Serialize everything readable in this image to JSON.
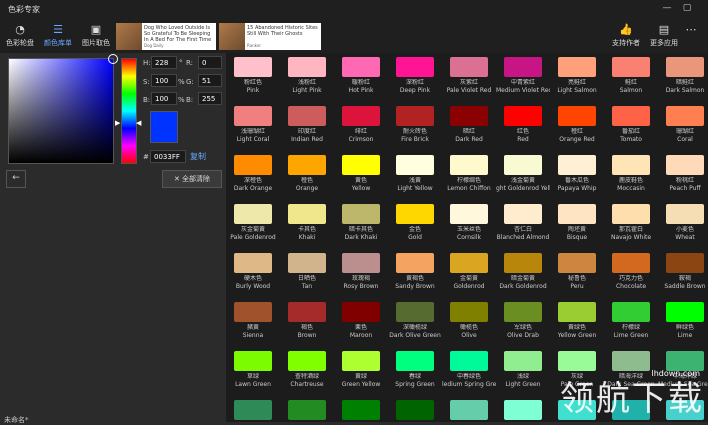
{
  "window": {
    "title": "色彩专家",
    "controls": [
      "—",
      "▢"
    ]
  },
  "toolbar": {
    "left": [
      {
        "icon": "palette-icon",
        "glyph": "◔",
        "label": "色彩轮盘",
        "active": false
      },
      {
        "icon": "list-icon",
        "glyph": "☰",
        "label": "颜色库单",
        "active": true
      },
      {
        "icon": "image-icon",
        "glyph": "▣",
        "label": "图片取色",
        "active": false
      }
    ],
    "right": [
      {
        "icon": "thumbs-up-icon",
        "glyph": "👍",
        "label": "支持作者"
      },
      {
        "icon": "apps-icon",
        "glyph": "▤",
        "label": "更多应用"
      },
      {
        "icon": "more-icon",
        "glyph": "⋯",
        "label": ""
      }
    ],
    "ads": [
      {
        "text": "Dog Who Loved Outside Is So Grateful To Be Sleeping In A Bed For The First Time",
        "src": "Dog Daily"
      },
      {
        "text": "15 Abandoned Historic Sites Still With Their Ghosts",
        "src": "Ranker"
      }
    ]
  },
  "picker": {
    "h_label": "H:",
    "h_value": "228",
    "s_label": "S:",
    "s_value": "100",
    "b_label": "B:",
    "b_value": "100",
    "r_label": "R:",
    "r_value": "0",
    "g_label": "G:",
    "g_value": "51",
    "bl_label": "B:",
    "bl_value": "255",
    "pct1": "%",
    "pct2": "%",
    "hex_label": "#",
    "hex_value": "0033FF",
    "copy_label": "复制",
    "back_label": "←",
    "clear_label": "✕ 全部清除",
    "current_color": "#0033ff"
  },
  "footer": {
    "unnamed": "未命名*"
  },
  "colors": [
    {
      "cn": "粉红色",
      "en": "Pink",
      "hex": "#ffc0cb"
    },
    {
      "cn": "浅粉红",
      "en": "Light Pink",
      "hex": "#ffb6c1"
    },
    {
      "cn": "暖粉红",
      "en": "Hot Pink",
      "hex": "#ff69b4"
    },
    {
      "cn": "深粉红",
      "en": "Deep Pink",
      "hex": "#ff1493"
    },
    {
      "cn": "灰紫红",
      "en": "Pale Violet Red",
      "hex": "#db7093"
    },
    {
      "cn": "中青紫红",
      "en": "Medium Violet Red",
      "hex": "#c71585"
    },
    {
      "cn": "亮鲑红",
      "en": "Light Salmon",
      "hex": "#ffa07a"
    },
    {
      "cn": "鲑红",
      "en": "Salmon",
      "hex": "#fa8072"
    },
    {
      "cn": "暗鲑红",
      "en": "Dark Salmon",
      "hex": "#e9967a"
    },
    {
      "cn": "浅珊瑚红",
      "en": "Light Coral",
      "hex": "#f08080"
    },
    {
      "cn": "印度红",
      "en": "Indian Red",
      "hex": "#cd5c5c"
    },
    {
      "cn": "绯红",
      "en": "Crimson",
      "hex": "#dc143c"
    },
    {
      "cn": "耐火砖色",
      "en": "Fire Brick",
      "hex": "#b22222"
    },
    {
      "cn": "暗红",
      "en": "Dark Red",
      "hex": "#8b0000"
    },
    {
      "cn": "红色",
      "en": "Red",
      "hex": "#ff0000"
    },
    {
      "cn": "橙红",
      "en": "Orange Red",
      "hex": "#ff4500"
    },
    {
      "cn": "番茄红",
      "en": "Tomato",
      "hex": "#ff6347"
    },
    {
      "cn": "珊瑚红",
      "en": "Coral",
      "hex": "#ff7f50"
    },
    {
      "cn": "深橙色",
      "en": "Dark Orange",
      "hex": "#ff8c00"
    },
    {
      "cn": "橙色",
      "en": "Orange",
      "hex": "#ffa500"
    },
    {
      "cn": "黄色",
      "en": "Yellow",
      "hex": "#ffff00"
    },
    {
      "cn": "浅黄",
      "en": "Light Yellow",
      "hex": "#ffffe0"
    },
    {
      "cn": "柠檬绸色",
      "en": "Lemon Chiffon",
      "hex": "#fffacd"
    },
    {
      "cn": "浅金菊黄",
      "en": "ght Goldenrod Yello",
      "hex": "#fafad2"
    },
    {
      "cn": "番木瓜色",
      "en": "Papaya Whip",
      "hex": "#ffefd5"
    },
    {
      "cn": "鹿皮鞋色",
      "en": "Moccasin",
      "hex": "#ffe4b5"
    },
    {
      "cn": "粉桃红",
      "en": "Peach Puff",
      "hex": "#ffdab9"
    },
    {
      "cn": "灰金菊黄",
      "en": "Pale Goldenrod",
      "hex": "#eee8aa"
    },
    {
      "cn": "卡其色",
      "en": "Khaki",
      "hex": "#f0e68c"
    },
    {
      "cn": "暗卡其色",
      "en": "Dark Khaki",
      "hex": "#bdb76b"
    },
    {
      "cn": "金色",
      "en": "Gold",
      "hex": "#ffd700"
    },
    {
      "cn": "玉米丝色",
      "en": "Cornsilk",
      "hex": "#fff8dc"
    },
    {
      "cn": "杏仁白",
      "en": "Blanched Almond",
      "hex": "#ffebcd"
    },
    {
      "cn": "陶坯黄",
      "en": "Bisque",
      "hex": "#ffe4c4"
    },
    {
      "cn": "那瓦霍白",
      "en": "Navajo White",
      "hex": "#ffdead"
    },
    {
      "cn": "小麦色",
      "en": "Wheat",
      "hex": "#f5deb3"
    },
    {
      "cn": "硬木色",
      "en": "Burly Wood",
      "hex": "#deb887"
    },
    {
      "cn": "日晒色",
      "en": "Tan",
      "hex": "#d2b48c"
    },
    {
      "cn": "玫瑰褐",
      "en": "Rosy Brown",
      "hex": "#bc8f8f"
    },
    {
      "cn": "黄褐色",
      "en": "Sandy Brown",
      "hex": "#f4a460"
    },
    {
      "cn": "金菊黄",
      "en": "Goldenrod",
      "hex": "#daa520"
    },
    {
      "cn": "暗金菊黄",
      "en": "Dark Goldenrod",
      "hex": "#b8860b"
    },
    {
      "cn": "秘鲁色",
      "en": "Peru",
      "hex": "#cd853f"
    },
    {
      "cn": "巧克力色",
      "en": "Chocolate",
      "hex": "#d2691e"
    },
    {
      "cn": "鞍褐",
      "en": "Saddle Brown",
      "hex": "#8b4513"
    },
    {
      "cn": "赭黄",
      "en": "Sienna",
      "hex": "#a0522d"
    },
    {
      "cn": "褐色",
      "en": "Brown",
      "hex": "#a52a2a"
    },
    {
      "cn": "栗色",
      "en": "Maroon",
      "hex": "#800000"
    },
    {
      "cn": "深橄榄绿",
      "en": "Dark Olive Green",
      "hex": "#556b2f"
    },
    {
      "cn": "橄榄色",
      "en": "Olive",
      "hex": "#808000"
    },
    {
      "cn": "军绿色",
      "en": "Olive Drab",
      "hex": "#6b8e23"
    },
    {
      "cn": "黄绿色",
      "en": "Yellow Green",
      "hex": "#9acd32"
    },
    {
      "cn": "柠檬绿",
      "en": "Lime Green",
      "hex": "#32cd32"
    },
    {
      "cn": "鲜绿色",
      "en": "Lime",
      "hex": "#00ff00"
    },
    {
      "cn": "草绿",
      "en": "Lawn Green",
      "hex": "#7cfc00"
    },
    {
      "cn": "查特酒绿",
      "en": "Chartreuse",
      "hex": "#7fff00"
    },
    {
      "cn": "黄绿",
      "en": "Green Yellow",
      "hex": "#adff2f"
    },
    {
      "cn": "春绿",
      "en": "Spring Green",
      "hex": "#00ff7f"
    },
    {
      "cn": "中春绿色",
      "en": "ledium Spring Gree",
      "hex": "#00fa9a"
    },
    {
      "cn": "浅绿",
      "en": "Light Green",
      "hex": "#90ee90"
    },
    {
      "cn": "灰绿",
      "en": "Pale Green",
      "hex": "#98fb98"
    },
    {
      "cn": "暗海洋绿",
      "en": "Dark Sea Green",
      "hex": "#8fbc8f"
    },
    {
      "cn": "中海洋绿",
      "en": "Medium Sea Green",
      "hex": "#3cb371"
    },
    {
      "cn": "",
      "en": "",
      "hex": "#2e8b57"
    },
    {
      "cn": "",
      "en": "",
      "hex": "#228b22"
    },
    {
      "cn": "",
      "en": "",
      "hex": "#008000"
    },
    {
      "cn": "",
      "en": "",
      "hex": "#006400"
    },
    {
      "cn": "",
      "en": "",
      "hex": "#66cdaa"
    },
    {
      "cn": "",
      "en": "",
      "hex": "#7fffd4"
    },
    {
      "cn": "",
      "en": "",
      "hex": "#40e0d0"
    },
    {
      "cn": "",
      "en": "",
      "hex": "#20b2aa"
    },
    {
      "cn": "",
      "en": "",
      "hex": "#48d1cc"
    }
  ],
  "watermark": {
    "text": "领航下载",
    "url": "lhdown.com"
  }
}
